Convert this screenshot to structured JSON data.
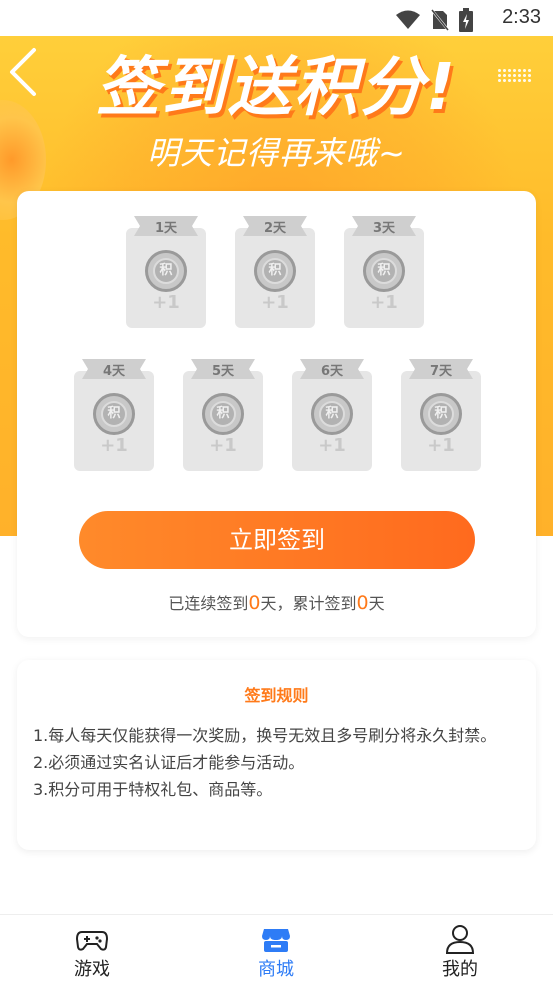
{
  "status_bar": {
    "time": "2:33"
  },
  "hero": {
    "title": "签到送积分!",
    "subtitle": "明天记得再来哦~"
  },
  "checkin": {
    "days": [
      {
        "label": "1天",
        "coin_text": "积",
        "reward": "+1"
      },
      {
        "label": "2天",
        "coin_text": "积",
        "reward": "+1"
      },
      {
        "label": "3天",
        "coin_text": "积",
        "reward": "+1"
      },
      {
        "label": "4天",
        "coin_text": "积",
        "reward": "+1"
      },
      {
        "label": "5天",
        "coin_text": "积",
        "reward": "+1"
      },
      {
        "label": "6天",
        "coin_text": "积",
        "reward": "+1"
      },
      {
        "label": "7天",
        "coin_text": "积",
        "reward": "+1"
      }
    ],
    "button_label": "立即签到",
    "streak_prefix": "已连续签到",
    "streak_days": "0",
    "streak_mid": "天，累计签到",
    "total_days": "0",
    "streak_suffix": "天"
  },
  "rules": {
    "title": "签到规则",
    "items": [
      "1.每人每天仅能获得一次奖励，换号无效且多号刷分将永久封禁。",
      "2.必须通过实名认证后才能参与活动。",
      "3.积分可用于特权礼包、商品等。"
    ]
  },
  "nav": {
    "items": [
      {
        "label": "游戏",
        "icon": "gamepad-icon"
      },
      {
        "label": "商城",
        "icon": "store-icon"
      },
      {
        "label": "我的",
        "icon": "user-icon"
      }
    ],
    "active_index": 1
  },
  "colors": {
    "accent": "#ff7a1a",
    "nav_active": "#2e7cf6",
    "hero_bg": "#ffbb2a"
  }
}
